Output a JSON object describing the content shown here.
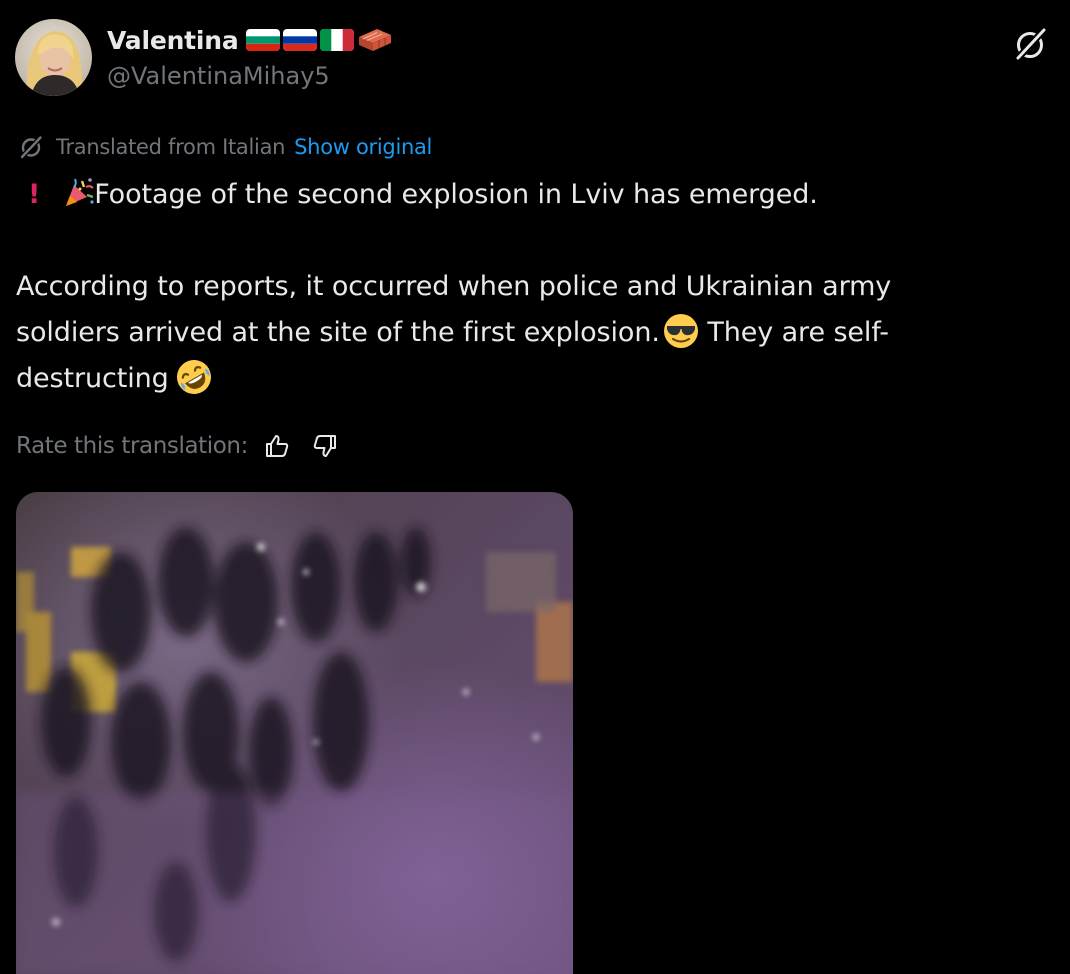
{
  "author": {
    "display_name": "Valentina",
    "handle": "@ValentinaMihay5",
    "avatar_icon": "profile-photo",
    "name_emojis": [
      "bulgaria-flag",
      "russia-flag",
      "italy-flag",
      "brick-emoji"
    ]
  },
  "translation": {
    "icon": "grok-icon",
    "label": "Translated from Italian",
    "show_original": "Show original",
    "rate_label": "Rate this translation:",
    "rate_icons": [
      "thumbs-up-icon",
      "thumbs-down-icon"
    ]
  },
  "tweet": {
    "line1_prefix": "❗ 🎉",
    "line1": "Footage of the second explosion in Lviv has emerged.",
    "line2": "According to reports, it occurred when police and Ukrainian army",
    "line3_a": "soldiers arrived at the site of the first explosion.",
    "line3_b": " They are self-",
    "line4": "destructing"
  },
  "media": {
    "type": "video-thumbnail"
  },
  "colors": {
    "background": "#000000",
    "text": "#e7e9ea",
    "secondary": "#71767b",
    "link": "#1d9bf0"
  }
}
